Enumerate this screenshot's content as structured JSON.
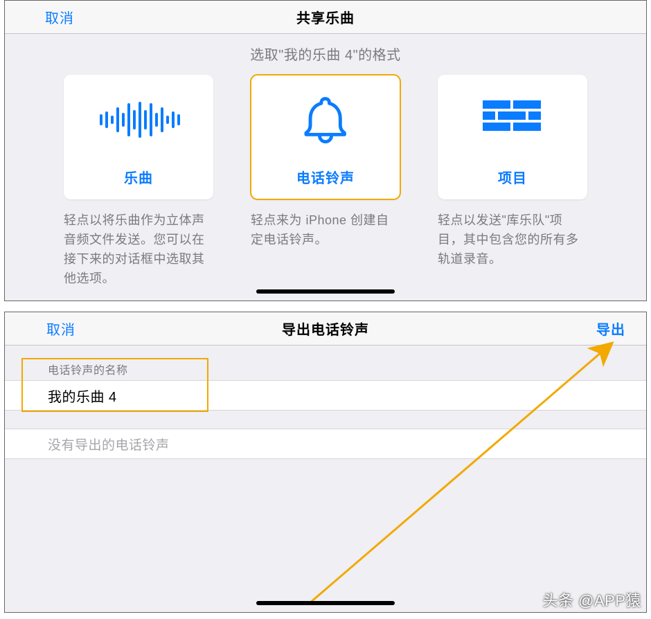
{
  "share": {
    "cancel": "取消",
    "title": "共享乐曲",
    "subtitle": "选取\"我的乐曲 4\"的格式",
    "cards": [
      {
        "label": "乐曲",
        "desc": "轻点以将乐曲作为立体声音频文件发送。您可以在接下来的对话框中选取其他选项。"
      },
      {
        "label": "电话铃声",
        "desc": "轻点来为 iPhone 创建自定电话铃声。"
      },
      {
        "label": "项目",
        "desc": "轻点以发送\"库乐队\"项目，其中包含您的所有多轨道录音。"
      }
    ]
  },
  "export": {
    "cancel": "取消",
    "title": "导出电话铃声",
    "action": "导出",
    "field_caption": "电话铃声的名称",
    "field_value": "我的乐曲 4",
    "empty_text": "没有导出的电话铃声"
  },
  "watermark": "头条 @APP猿"
}
